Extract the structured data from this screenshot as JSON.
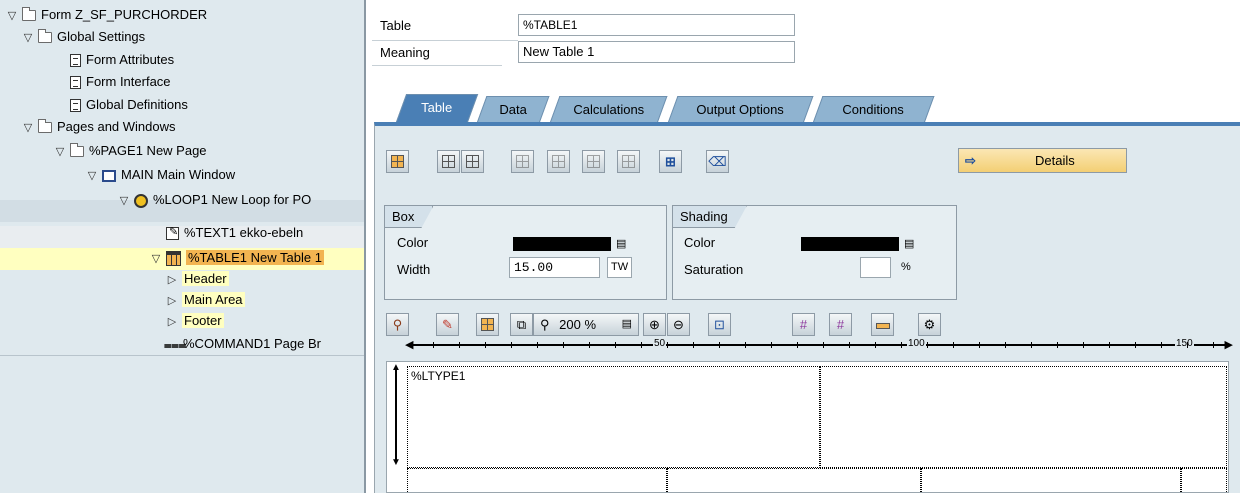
{
  "tree": {
    "items": [
      {
        "label": "Form Z_SF_PURCHORDER",
        "icon": "folder-icon",
        "expanded": true
      },
      {
        "label": "Global Settings",
        "icon": "folder-icon",
        "expanded": true
      },
      {
        "label": "Form Attributes",
        "icon": "document-icon"
      },
      {
        "label": "Form Interface",
        "icon": "document-icon"
      },
      {
        "label": "Global Definitions",
        "icon": "document-icon"
      },
      {
        "label": "Pages and Windows",
        "icon": "folder-icon",
        "expanded": true
      },
      {
        "label": "%PAGE1 New Page",
        "icon": "folder-icon",
        "expanded": true
      },
      {
        "label": "MAIN Main Window",
        "icon": "window-icon",
        "expanded": true
      },
      {
        "label": "%LOOP1 New Loop for PO",
        "icon": "loop-icon",
        "expanded": true
      },
      {
        "label": "%TEXT1 ekko-ebeln",
        "icon": "text-edit-icon"
      },
      {
        "label": "%TABLE1 New Table 1",
        "icon": "table-icon",
        "expanded": true,
        "selected": true
      },
      {
        "label": "Header",
        "collapsed": true
      },
      {
        "label": "Main Area",
        "collapsed": true
      },
      {
        "label": "Footer",
        "collapsed": true
      },
      {
        "label": "%COMMAND1 Page Br",
        "icon": "command-icon"
      }
    ]
  },
  "header": {
    "table_label": "Table",
    "table_value": "%TABLE1",
    "meaning_label": "Meaning",
    "meaning_value": "New Table 1"
  },
  "tabs": [
    {
      "label": "Table",
      "active": true
    },
    {
      "label": "Data"
    },
    {
      "label": "Calculations"
    },
    {
      "label": "Output Options"
    },
    {
      "label": "Conditions"
    }
  ],
  "toolbar1": {
    "details_label": "Details"
  },
  "box": {
    "title": "Box",
    "color_label": "Color",
    "width_label": "Width",
    "width_value": "15.00",
    "width_unit": "TW"
  },
  "shading": {
    "title": "Shading",
    "color_label": "Color",
    "saturation_label": "Saturation",
    "saturation_value": "",
    "saturation_unit": "%"
  },
  "toolbar2": {
    "zoom_value": "200 %"
  },
  "ruler": {
    "labels": [
      "50",
      "100",
      "150"
    ]
  },
  "canvas": {
    "line_type": "%LTYPE1"
  },
  "colors": {
    "tree_bg": "#dfe9ee",
    "tab_active": "#4a7fb5",
    "tab_inactive": "#8fb3d0",
    "highlight": "#ffffc0",
    "details_button": "#f3cf74"
  }
}
